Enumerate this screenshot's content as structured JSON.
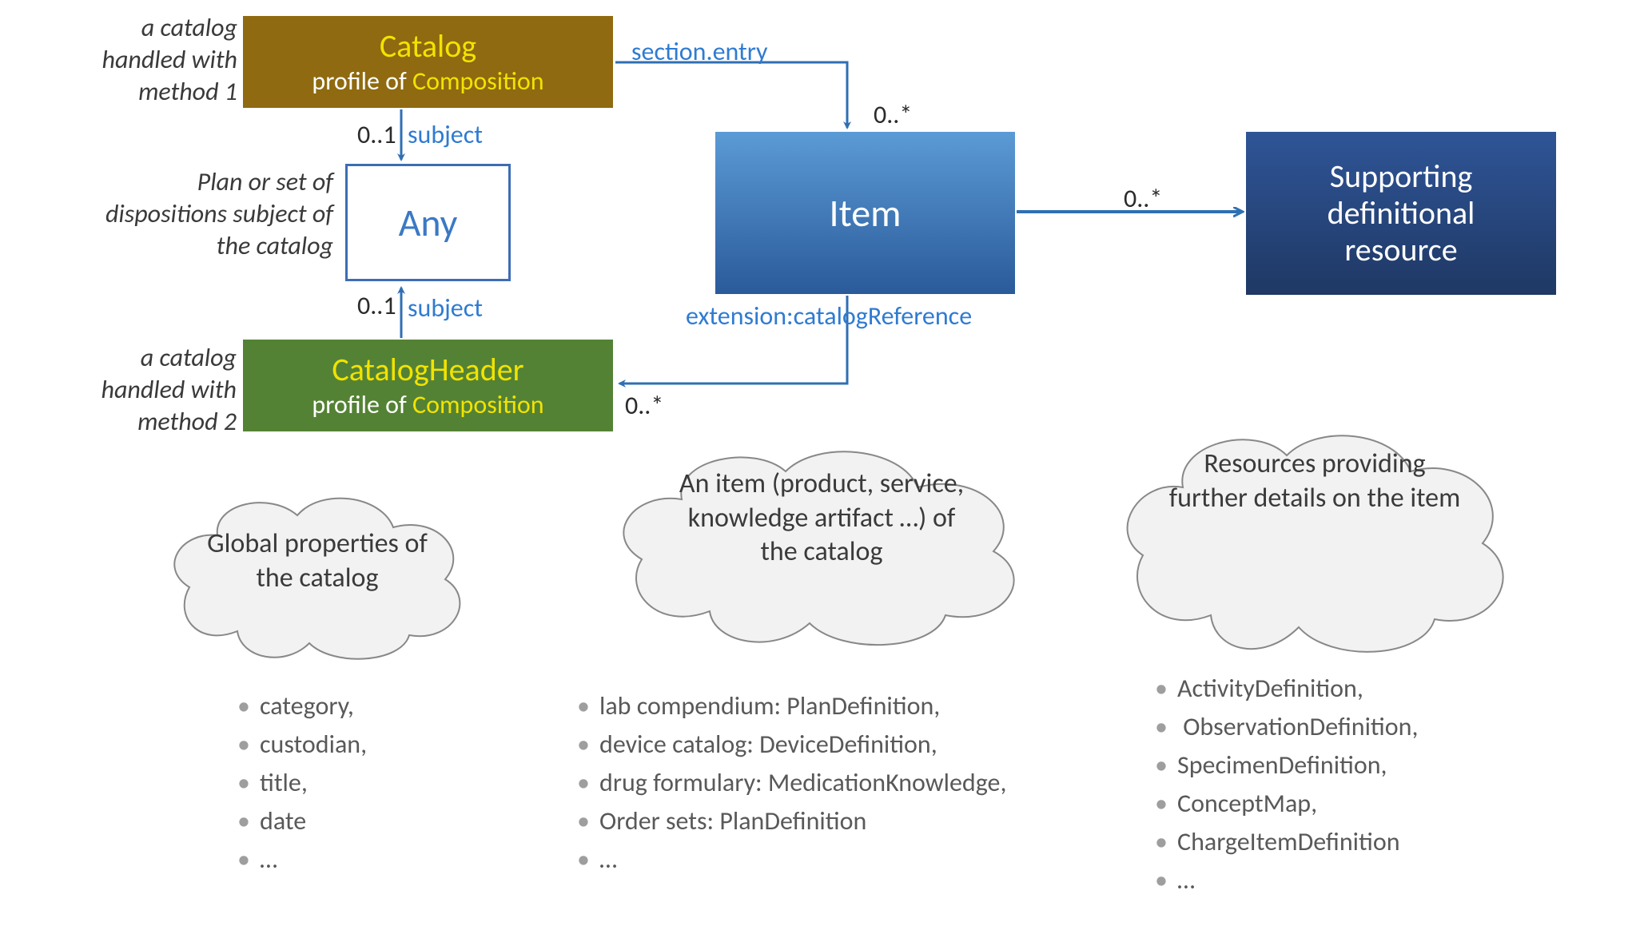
{
  "annotations": {
    "method1": "a catalog handled with method 1",
    "any_desc": "Plan or set of dispositions subject of the catalog",
    "method2": "a catalog handled with method 2"
  },
  "boxes": {
    "catalog": {
      "title": "Catalog",
      "sub_pre": "profile of ",
      "sub_em": "Composition"
    },
    "any": "Any",
    "header": {
      "title": "CatalogHeader",
      "sub_pre": "profile of ",
      "sub_em": "Composition"
    },
    "item": "Item",
    "supporting_l1": "Supporting",
    "supporting_l2": "definitional",
    "supporting_l3": "resource"
  },
  "relations": {
    "section_entry": "section.entry",
    "subject1": "subject",
    "subject2": "subject",
    "ext_catref": "extension:catalogReference"
  },
  "cards": {
    "subj1": "0..1",
    "subj2": "0..1",
    "to_item": "0..*",
    "to_supporting": "0..*",
    "to_header": "0..*"
  },
  "clouds": {
    "global": "Global properties of the catalog",
    "item": "An item (product, service, knowledge artifact …) of the catalog",
    "supporting": "Resources providing further details on the item"
  },
  "bullets": {
    "global": [
      "category,",
      "custodian,",
      "title,",
      "date",
      "…"
    ],
    "item": [
      "lab compendium: PlanDefinition,",
      "device catalog: DeviceDefinition,",
      "drug formulary: MedicationKnowledge,",
      "Order sets: PlanDefinition",
      "…"
    ],
    "supporting": [
      "ActivityDefinition,",
      " ObservationDefinition,",
      "SpecimenDefinition,",
      "ConceptMap,",
      "ChargeItemDefinition",
      "…"
    ]
  }
}
